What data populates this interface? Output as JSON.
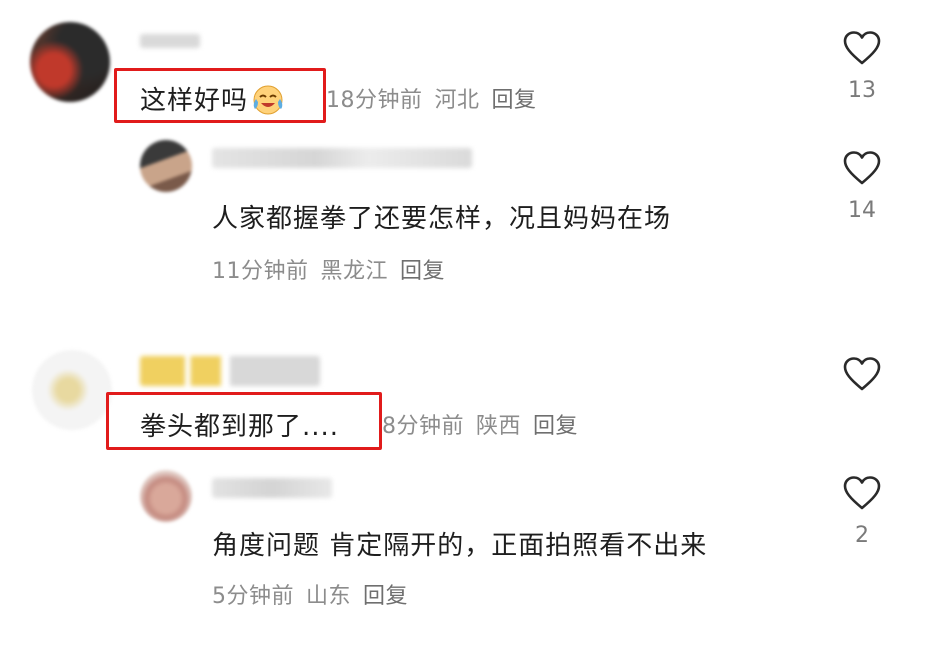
{
  "comments": [
    {
      "text": "这样好吗",
      "emoji": "crying-laughing-emoji",
      "time": "18分钟前",
      "location": "河北",
      "reply_label": "回复",
      "likes": "13",
      "reply": {
        "text": "人家都握拳了还要怎样，况且妈妈在场",
        "time": "11分钟前",
        "location": "黑龙江",
        "reply_label": "回复",
        "likes": "14"
      }
    },
    {
      "text": "拳头都到那了....",
      "time": "8分钟前",
      "location": "陕西",
      "reply_label": "回复",
      "likes": "",
      "reply": {
        "text": "角度问题 肯定隔开的，正面拍照看不出来",
        "time": "5分钟前",
        "location": "山东",
        "reply_label": "回复",
        "likes": "2"
      }
    }
  ],
  "colors": {
    "highlight": "#e11b1b",
    "meta": "#8c8c8c",
    "text": "#1e1e1e"
  }
}
